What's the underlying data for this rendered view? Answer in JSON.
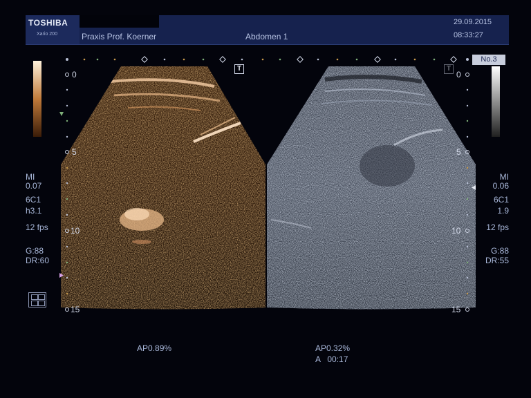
{
  "header": {
    "brand": "TOSHIBA",
    "model": "Xario 200",
    "institution": "Praxis Prof. Koerner",
    "preset": "Abdomen 1",
    "date": "29.09.2015",
    "time": "08:33:27"
  },
  "badge": {
    "label": "No.3"
  },
  "left_panel": {
    "params": {
      "mi_label": "MI",
      "mi_value": "0.07",
      "probe": "6C1",
      "harmonic": "h3.1",
      "frame_rate": "12 fps",
      "gain": "G:88",
      "dynamic_range": "DR:60"
    },
    "footer": "AP0.89%"
  },
  "right_panel": {
    "params": {
      "mi_label": "MI",
      "mi_value": "0.06",
      "probe": "6C1",
      "frequency": "1.9",
      "frame_rate": "12 fps",
      "gain": "G:88",
      "dynamic_range": "DR:55"
    },
    "footer_power": "AP0.32%",
    "footer_timer": "A   00:17"
  },
  "depth_scale": {
    "labels": [
      "0",
      "5",
      "10",
      "15"
    ]
  },
  "icons": {
    "orientation_marker": "T",
    "cine_icon": "film-icon",
    "focus_marker": "triangle-icon"
  },
  "colors": {
    "header_bg": "#16224e",
    "text": "#a9b8da",
    "contrast_tint": "#b06a2a",
    "bmode_tint": "#8a9ab8"
  }
}
